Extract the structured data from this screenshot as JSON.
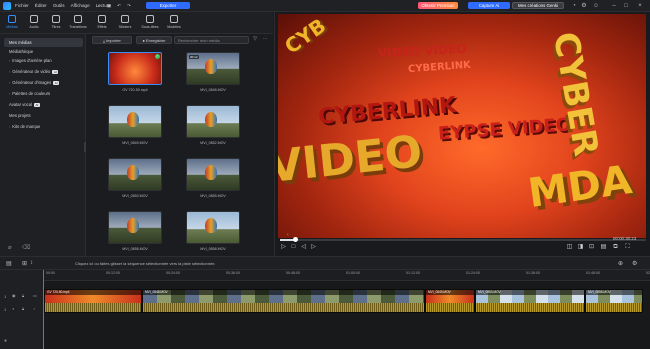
{
  "titlebar": {
    "menu": [
      "Fichier",
      "Éditer",
      "Outils",
      "Affichage",
      "Lecture"
    ],
    "export_label": "Exporter",
    "project_title": " ",
    "premium_label": "Obtenir Premium",
    "create_label": "Capture Ai",
    "my_creations_label": "Mes créations Genki"
  },
  "tabs": [
    "Médias",
    "Audio",
    "Titres",
    "Transitions",
    "Effets",
    "Stickers",
    "Sous-titres",
    "Modèles"
  ],
  "leftnav": {
    "items": [
      {
        "label": "Mes médias",
        "arrow": "",
        "badge": ""
      },
      {
        "label": "Médiathèque",
        "arrow": "",
        "badge": ""
      },
      {
        "label": "Images d'arrière-plan",
        "arrow": "›",
        "badge": ""
      },
      {
        "label": "Générateur de vidéo",
        "arrow": "›",
        "badge": "AI"
      },
      {
        "label": "Générateur d'images",
        "arrow": "›",
        "badge": "AI"
      },
      {
        "label": "Palettes de couleurs",
        "arrow": "›",
        "badge": ""
      },
      {
        "label": "Avatar vocal",
        "arrow": "",
        "badge": "AI"
      },
      {
        "label": "Mes projets",
        "arrow": "",
        "badge": ""
      },
      {
        "label": "Kits de marque",
        "arrow": "›",
        "badge": ""
      }
    ]
  },
  "media": {
    "import_label": "Importer",
    "record_label": "Enregistrer",
    "search_placeholder": "Rechercher mon média",
    "items": [
      {
        "caption": "GV 720-50.mp4",
        "duration": "",
        "kind": "red",
        "selected": true
      },
      {
        "caption": "MVI_0848.MOV",
        "duration": "00:12",
        "kind": "dusk",
        "selected": false
      },
      {
        "caption": "MVI_0849.MOV",
        "duration": "",
        "kind": "sky",
        "selected": false
      },
      {
        "caption": "MVI_0852.MOV",
        "duration": "",
        "kind": "sky",
        "selected": false
      },
      {
        "caption": "MVI_0853.MOV",
        "duration": "",
        "kind": "dusk",
        "selected": false
      },
      {
        "caption": "MVI_0855.MOV",
        "duration": "",
        "kind": "dusk",
        "selected": false
      },
      {
        "caption": "MVI_0858.MOV",
        "duration": "",
        "kind": "dusk",
        "selected": false
      },
      {
        "caption": "MVI_0858.MOV",
        "duration": "",
        "kind": "sky",
        "selected": false
      }
    ]
  },
  "preview": {
    "timecode": "00:00:30:23",
    "progress": 0.04
  },
  "timeline": {
    "hint": "Cliquez ici ou faites glisser la séquence sélectionnée vers la piste sélectionnée.",
    "ticks": [
      "00:00",
      "00:12:00",
      "00:24:00",
      "00:36:00",
      "00:48:00",
      "01:00:00",
      "01:12:00",
      "01:24:00",
      "01:36:00",
      "01:48:00",
      "02:00:00"
    ],
    "clips": [
      {
        "label": "GV 720-50.mp4",
        "kind": "red"
      },
      {
        "label": "MVI_0848.MOV",
        "kind": "dusk"
      },
      {
        "label": "MVI_0849.MOV",
        "kind": "red"
      },
      {
        "label": "MVI_0853.MOV",
        "kind": "sky"
      },
      {
        "label": "MVI_0858.MOV",
        "kind": "sky"
      }
    ]
  },
  "colors": {
    "accent": "#2f6bff",
    "premium": "#ff5a7a",
    "playhead": "#ff3b3b"
  }
}
